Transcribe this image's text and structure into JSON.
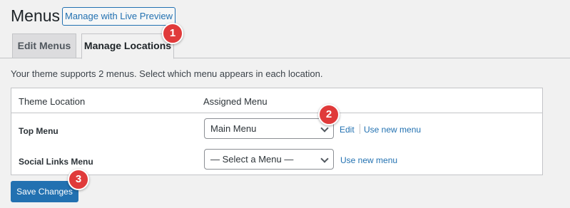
{
  "header": {
    "title": "Menus",
    "live_preview_label": "Manage with Live Preview"
  },
  "tabs": [
    {
      "label": "Edit Menus",
      "active": false
    },
    {
      "label": "Manage Locations",
      "active": true
    }
  ],
  "intro_text": "Your theme supports 2 menus. Select which menu appears in each location.",
  "table": {
    "headers": [
      "Theme Location",
      "Assigned Menu"
    ],
    "rows": [
      {
        "location": "Top Menu",
        "selected": "Main Menu",
        "edit_label": "Edit",
        "use_new_label": "Use new menu"
      },
      {
        "location": "Social Links Menu",
        "selected": "— Select a Menu —",
        "use_new_label": "Use new menu"
      }
    ]
  },
  "save_label": "Save Changes",
  "badges": [
    "1",
    "2",
    "3"
  ],
  "colors": {
    "accent": "#2271b1",
    "badge": "#e03a3a",
    "background": "#f1f1f1"
  }
}
